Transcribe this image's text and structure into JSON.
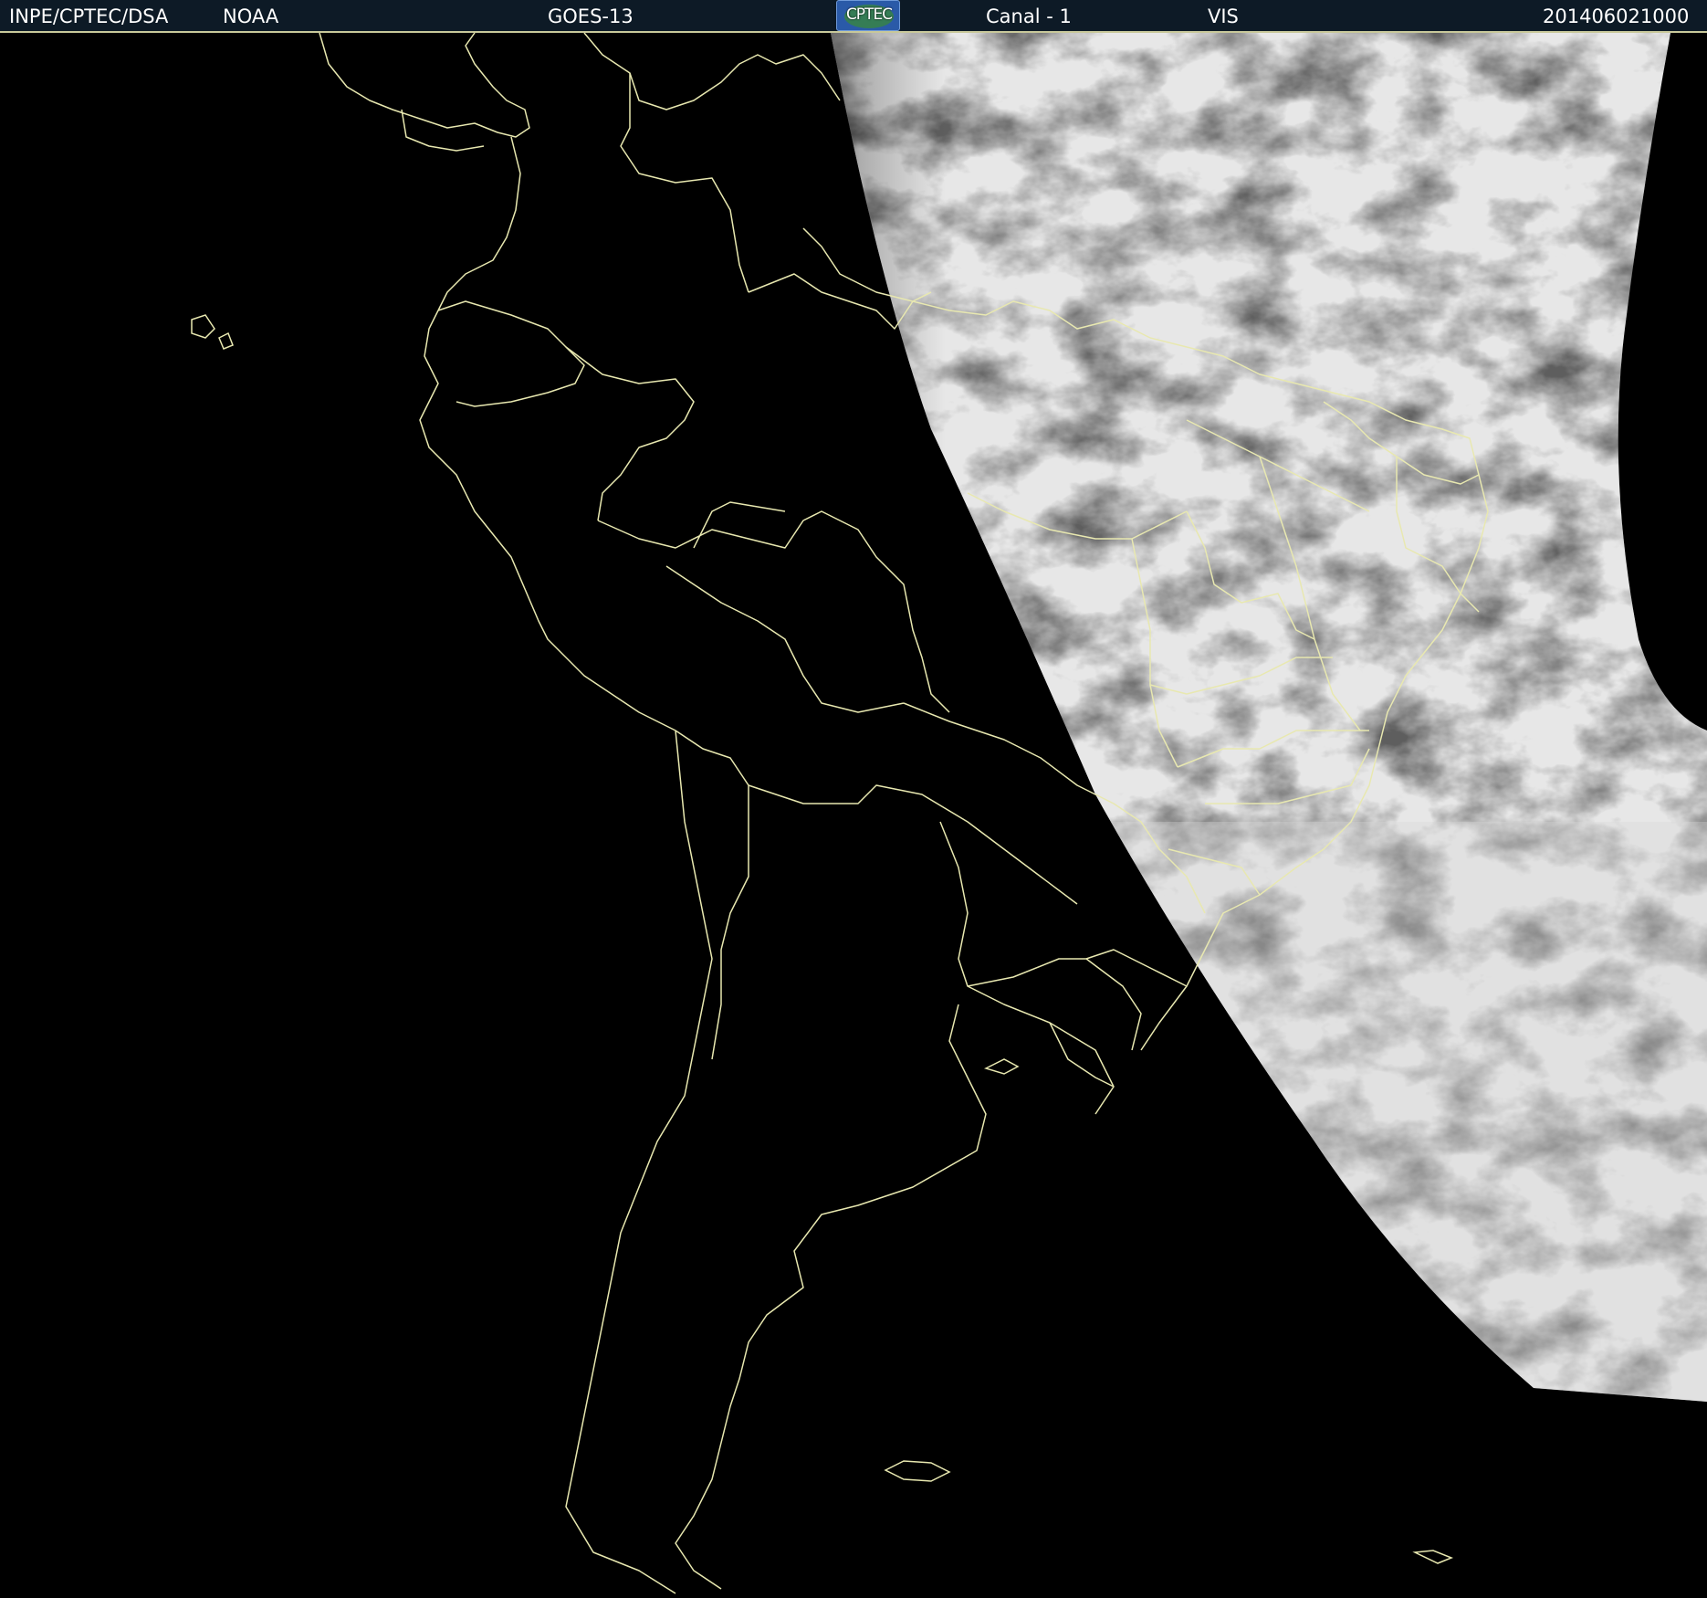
{
  "header": {
    "agency": "INPE/CPTEC/DSA",
    "source": "NOAA",
    "satellite": "GOES-13",
    "logo_text": "CPTEC",
    "channel": "Canal - 1",
    "band": "VIS",
    "timestamp": "201406021000"
  },
  "colors": {
    "background": "#000000",
    "header_bg": "#0d1a26",
    "border_lines": "#e8e8b0",
    "cloud_gray": "#6a6a6a"
  },
  "icons": {
    "logo": "cptec-logo-icon"
  }
}
